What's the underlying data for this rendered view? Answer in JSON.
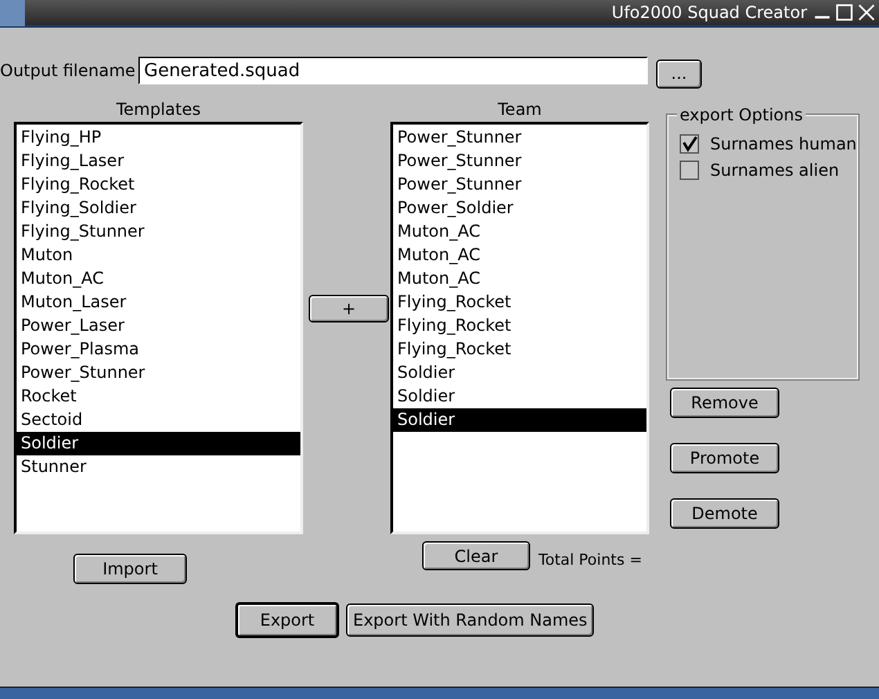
{
  "window": {
    "title": "Ufo2000 Squad Creator"
  },
  "output": {
    "label": "Output filename",
    "value": "Generated.squad",
    "browse_button": "..."
  },
  "templates": {
    "label": "Templates",
    "items": [
      {
        "label": "Flying_HP",
        "selected": false
      },
      {
        "label": "Flying_Laser",
        "selected": false
      },
      {
        "label": "Flying_Rocket",
        "selected": false
      },
      {
        "label": "Flying_Soldier",
        "selected": false
      },
      {
        "label": "Flying_Stunner",
        "selected": false
      },
      {
        "label": "Muton",
        "selected": false
      },
      {
        "label": "Muton_AC",
        "selected": false
      },
      {
        "label": "Muton_Laser",
        "selected": false
      },
      {
        "label": "Power_Laser",
        "selected": false
      },
      {
        "label": "Power_Plasma",
        "selected": false
      },
      {
        "label": "Power_Stunner",
        "selected": false
      },
      {
        "label": "Rocket",
        "selected": false
      },
      {
        "label": "Sectoid",
        "selected": false
      },
      {
        "label": "Soldier",
        "selected": true
      },
      {
        "label": "Stunner",
        "selected": false
      }
    ],
    "button": "Import"
  },
  "add_button": "+",
  "team": {
    "label": "Team",
    "items": [
      {
        "label": "Power_Stunner",
        "selected": false
      },
      {
        "label": "Power_Stunner",
        "selected": false
      },
      {
        "label": "Power_Stunner",
        "selected": false
      },
      {
        "label": "Power_Soldier",
        "selected": false
      },
      {
        "label": "Muton_AC",
        "selected": false
      },
      {
        "label": "Muton_AC",
        "selected": false
      },
      {
        "label": "Muton_AC",
        "selected": false
      },
      {
        "label": "Flying_Rocket",
        "selected": false
      },
      {
        "label": "Flying_Rocket",
        "selected": false
      },
      {
        "label": "Flying_Rocket",
        "selected": false
      },
      {
        "label": "Soldier",
        "selected": false
      },
      {
        "label": "Soldier",
        "selected": false
      },
      {
        "label": "Soldier",
        "selected": true
      }
    ],
    "clear_button": "Clear",
    "total_points": "Total Points ="
  },
  "export_options": {
    "title": "export Options",
    "options": [
      {
        "label": "Surnames human",
        "checked": true
      },
      {
        "label": "Surnames alien",
        "checked": false
      }
    ]
  },
  "side_buttons": [
    "Remove",
    "Promote",
    "Demote"
  ],
  "bottom_buttons": [
    {
      "label": "Export",
      "default": true
    },
    {
      "label": "Export With Random Names",
      "default": false
    }
  ]
}
